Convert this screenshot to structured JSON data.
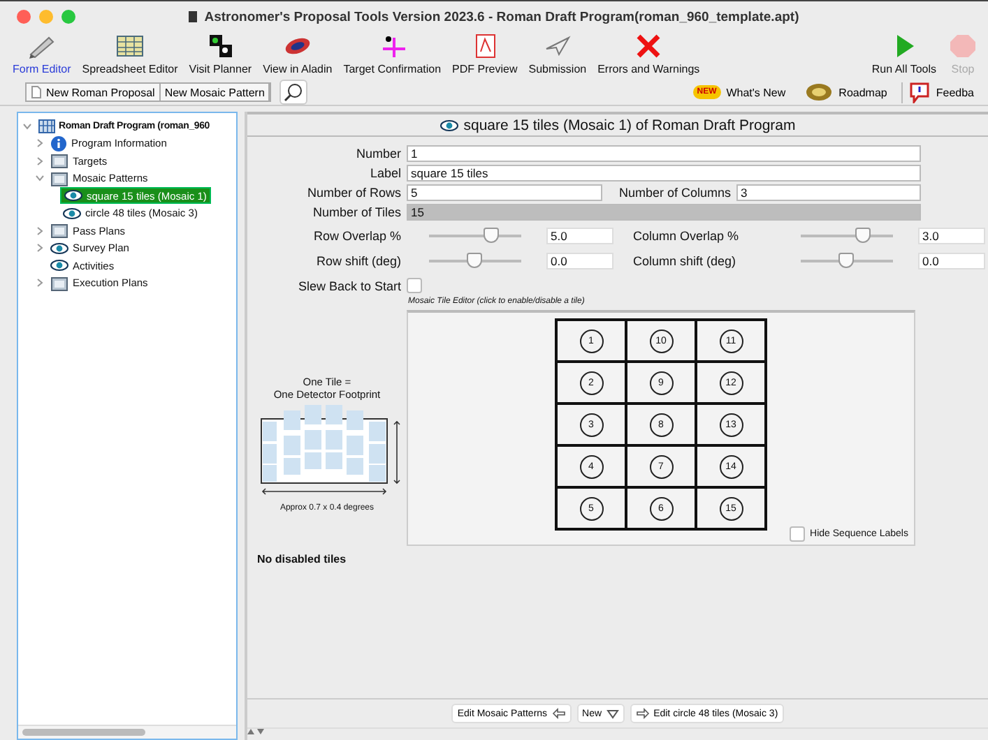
{
  "window": {
    "title": "Astronomer's Proposal Tools Version 2023.6  - Roman Draft Program(roman_960_template.apt)"
  },
  "toolbar": [
    {
      "label": "Form Editor",
      "kind": "pencil",
      "selected": true
    },
    {
      "label": "Spreadsheet Editor",
      "kind": "sheet",
      "selected": false
    },
    {
      "label": "Visit Planner",
      "kind": "planner",
      "selected": false
    },
    {
      "label": "View in Aladin",
      "kind": "galaxy",
      "selected": false
    },
    {
      "label": "Target Confirmation",
      "kind": "target",
      "selected": false
    },
    {
      "label": "PDF Preview",
      "kind": "pdf",
      "selected": false
    },
    {
      "label": "Submission",
      "kind": "plane",
      "selected": false
    },
    {
      "label": "Errors and Warnings",
      "kind": "x",
      "selected": false
    }
  ],
  "run_tools": [
    {
      "label": "Run All Tools",
      "kind": "play",
      "disabled": false
    },
    {
      "label": "Stop",
      "kind": "stop",
      "disabled": true
    }
  ],
  "secondary_bar": {
    "new_buttons": [
      "New Roman Proposal",
      "New Mosaic Pattern"
    ],
    "whats_new_badge": "NEW",
    "links": [
      {
        "label": "What's New",
        "kind": "new"
      },
      {
        "label": "Roadmap",
        "kind": "compass"
      },
      {
        "label": "Feedba",
        "kind": "feedback"
      }
    ]
  },
  "tree": [
    {
      "label": "Roman Draft Program (roman_960",
      "kind": "program",
      "expanded": true,
      "selected": false,
      "children": [
        {
          "label": "Program Information",
          "kind": "info",
          "expanded": false,
          "selected": false
        },
        {
          "label": "Targets",
          "kind": "folder",
          "expanded": false,
          "selected": false
        },
        {
          "label": "Mosaic Patterns",
          "kind": "folder",
          "expanded": true,
          "selected": false,
          "children": [
            {
              "label": "square 15 tiles (Mosaic 1)",
              "kind": "eye",
              "selected": true
            },
            {
              "label": "circle 48 tiles (Mosaic 3)",
              "kind": "eye",
              "selected": false
            }
          ]
        },
        {
          "label": "Pass Plans",
          "kind": "folder",
          "expanded": false,
          "selected": false
        },
        {
          "label": "Survey Plan",
          "kind": "eye",
          "expanded": false,
          "selected": false
        },
        {
          "label": "Activities",
          "kind": "eye",
          "selected": false
        },
        {
          "label": "Execution Plans",
          "kind": "folder",
          "expanded": false,
          "selected": false
        }
      ]
    }
  ],
  "editor": {
    "title": "square 15 tiles (Mosaic 1) of Roman Draft Program",
    "number": {
      "label": "Number",
      "value": "1"
    },
    "label": {
      "label": "Label",
      "value": "square 15 tiles"
    },
    "rows": {
      "label": "Number of Rows",
      "value": "5"
    },
    "columns": {
      "label": "Number of Columns",
      "value": "3"
    },
    "tiles": {
      "label": "Number of Tiles",
      "value": "15"
    },
    "sliders": [
      {
        "label": "Row Overlap %",
        "level": 0.68,
        "reading": "5.0"
      },
      {
        "label": "Column Overlap %",
        "level": 0.68,
        "reading": "3.0"
      },
      {
        "label": "Row shift (deg)",
        "level": 0.5,
        "reading": "0.0"
      },
      {
        "label": "Column shift (deg)",
        "level": 0.5,
        "reading": "0.0"
      }
    ],
    "slew_back": {
      "label": "Slew Back to Start",
      "checked": false
    },
    "tile_editor": {
      "caption": "Mosaic Tile Editor (click to enable/disable a tile)",
      "grid": [
        [
          "1",
          "10",
          "11"
        ],
        [
          "2",
          "9",
          "12"
        ],
        [
          "3",
          "8",
          "13"
        ],
        [
          "4",
          "7",
          "14"
        ],
        [
          "5",
          "6",
          "15"
        ]
      ],
      "hide_labels": {
        "label": "Hide Sequence Labels",
        "checked": false
      }
    },
    "footprint": {
      "title": "One Tile =\nOne Detector Footprint",
      "caption": "Approx 0.7 x 0.4 degrees"
    },
    "disabled_note": "No disabled tiles"
  },
  "bottom_buttons": [
    {
      "label": "Edit Mosaic Patterns",
      "kind": "back"
    },
    {
      "label": "New",
      "kind": "caret"
    },
    {
      "label": "Edit circle 48 tiles (Mosaic 3)",
      "kind": "forward"
    }
  ]
}
